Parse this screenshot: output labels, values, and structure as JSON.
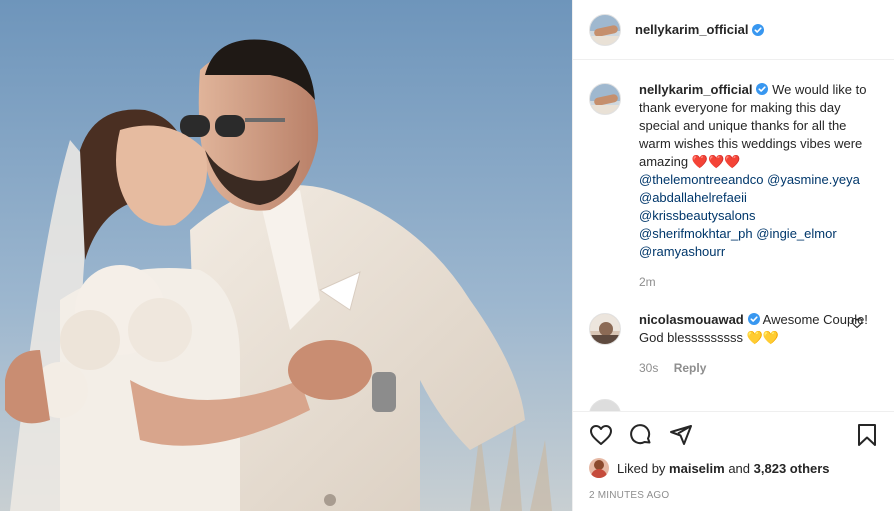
{
  "header": {
    "username": "nellykarim_official"
  },
  "caption": {
    "username": "nellykarim_official",
    "text": "We would like to thank everyone for making this day special and unique thanks for all the warm wishes this weddings vibes were amazing",
    "hearts": "❤️❤️❤️",
    "mentions": [
      "@thelemontreeandco",
      "@yasmine.yeya",
      "@abdallahelrefaeii",
      "@krissbeautysalons",
      "@sherifmokhtar_ph",
      "@ingie_elmor",
      "@ramyashourr"
    ],
    "time": "2m"
  },
  "comment": {
    "username": "nicolasmouawad",
    "text": "Awesome Couple! God blesssssssss",
    "emoji": "💛💛",
    "time": "30s",
    "reply_label": "Reply"
  },
  "likes": {
    "prefix": "Liked by",
    "user": "maiselim",
    "joiner": "and",
    "others": "3,823 others"
  },
  "posted": "2 MINUTES AGO",
  "colors": {
    "verified": "#3897f0",
    "link": "#00376b",
    "muted": "#8e8e8e",
    "heart": "#e0245e",
    "yellow_heart": "#ffcc00"
  },
  "icons": [
    "heart-icon",
    "comment-icon",
    "share-icon",
    "bookmark-icon",
    "verified-badge-icon"
  ]
}
